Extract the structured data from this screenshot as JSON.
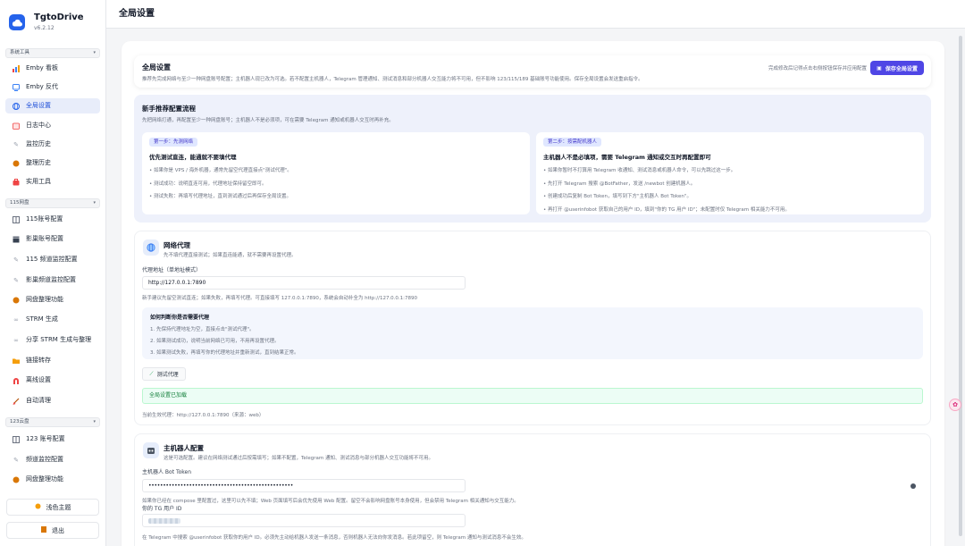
{
  "app": {
    "name": "TgtoDrive",
    "version": "v6.2.12"
  },
  "groups": {
    "system": "系统工具",
    "p115": "115网盘",
    "p123": "123云盘"
  },
  "nav": {
    "emby_board": "Emby 看板",
    "emby_proxy": "Emby 反代",
    "global_settings": "全局设置",
    "log_center": "日志中心",
    "monitor_history": "监控历史",
    "organize_history": "整理历史",
    "utilities": "实用工具",
    "acc115": "115账号配置",
    "media_acc": "影巢账号配置",
    "ch115": "115 频道监控配置",
    "media_ch": "影巢频道监控配置",
    "organize115": "网盘整理功能",
    "strm": "STRM 生成",
    "share_strm": "分享 STRM 生成与整理",
    "link_transfer": "链接转存",
    "offline": "离线设置",
    "auto_clean": "自动清理",
    "acc123": "123 账号配置",
    "ch123": "频道监控配置",
    "organize123": "网盘整理功能"
  },
  "footer": {
    "theme": "浅色主题",
    "logout": "退出"
  },
  "page_title": "全局设置",
  "global_panel": {
    "title": "全局设置",
    "desc": "推荐先完成网络与至少一种网盘账号配置；主机器人现已改为可选。若不配置主机器人，Telegram 管理通知、测试消息和部分机器人交互能力将不可用，但不影响 123/115/189 基础账号功能使用。保存全局设置会发送重启指令。",
    "hint": "完成修改后记得点击右侧按钮保存并应用配置",
    "save": "保存全局设置"
  },
  "recommend": {
    "title": "新手推荐配置流程",
    "desc": "先把网络打通，再配置至少一种网盘账号；主机器人不是必须项，可在需要 Telegram 通知或机器人交互时再补充。",
    "step1": {
      "badge": "第一步：先测网络",
      "title": "优先测试直连，能通就不要填代理",
      "items": [
        "如果你是 VPS / 海外机器，通常先留空代理直接点\"测试代理\"。",
        "测试成功：说明直连可用，代理地址保持留空即可。",
        "测试失败：再填写代理地址，直到测试通过后再保存全局设置。"
      ]
    },
    "step2": {
      "badge": "第二步：按需配机器人",
      "title": "主机器人不是必填项，需要 Telegram 通知或交互时再配置即可",
      "items": [
        "如果你暂时不打算用 Telegram 收通知、测试消息或机器人命令，可以先跳过这一步。",
        "先打开 Telegram 搜索 @BotFather，发送 /newbot 创建机器人。",
        "创建成功后复制 Bot Token，填写到下方\"主机器人 Bot Token\"。",
        "再打开 @userinfobot 获取自己的用户 ID，填到\"你的 TG 用户 ID\"；未配置时仅 Telegram 相关能力不可用。"
      ]
    }
  },
  "proxy": {
    "title": "网络代理",
    "desc": "先不填代理直接测试；如果直连能通，就不需要再设置代理。",
    "label": "代理地址（单地址模式）",
    "value": "http://127.0.0.1:7890",
    "help": "新手建议先留空测试直连；如果失败，再填写代理。可直接填写 127.0.0.1:7890，系统会自动补全为 http://127.0.0.1:7890",
    "howto_title": "如何判断你是否需要代理",
    "howto_items": [
      "1. 先保持代理地址为空，直接点击\"测试代理\"。",
      "2. 如果测试成功，说明当前网络已可用，不用再设置代理。",
      "3. 如果测试失败，再填写你的代理地址并重新测试，直到结果正常。"
    ],
    "test": "测试代理",
    "loaded": "全局设置已加载",
    "current": "当前生效代理：http://127.0.0.1:7890（来源：web）"
  },
  "bot": {
    "title": "主机器人配置",
    "desc": "这是可选配置。建议在网络测试通过后按需填写；如果不配置，Telegram 通知、测试消息与部分机器人交互功能将不可用。",
    "token_label": "主机器人 Bot Token",
    "token_value": "••••••••••••••••••••••••••••••••••••••••••••••••••",
    "token_help": "如果你已经在 compose 里配置过，这里可以先不填；Web 页面填写后会优先使用 Web 配置。留空不会影响网盘账号本身使用，但会禁用 Telegram 相关通知与交互能力。",
    "uid_label": "你的 TG 用户 ID",
    "uid_help": "在 Telegram 中搜索 @userinfobot 获取你的用户 ID。必须先主动给机器人发送一条消息，否则机器人无法向你发消息。若此项留空，则 Telegram 通知与测试消息不会生效。"
  },
  "colors": {
    "accent": "#4f46e5",
    "active_bg": "#e8edfa",
    "success_bg": "#ecfdf5"
  }
}
